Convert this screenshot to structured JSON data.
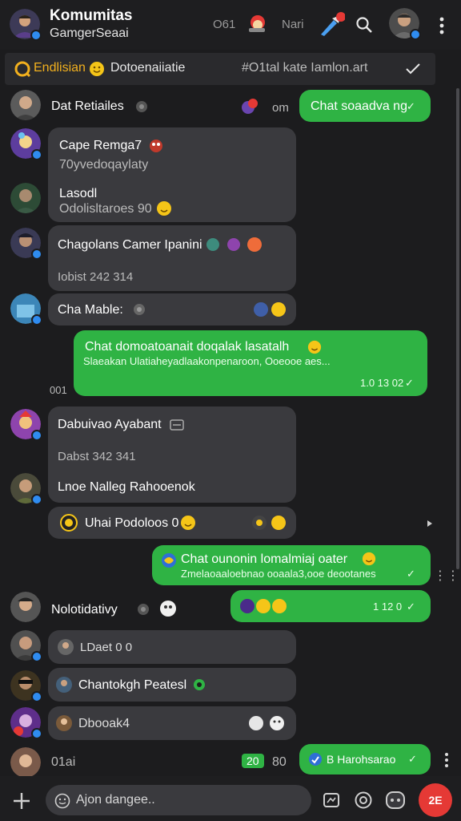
{
  "header": {
    "title": "Komumitas",
    "subtitle": "GamgerSeaai",
    "time_label": "O61",
    "alt_label": "Nari",
    "notif_count": "1"
  },
  "pinned": {
    "label": "Endlisian",
    "text": "Dotoenaiiatie",
    "right_text": "#O1tal kate Iamlon.art"
  },
  "messages": {
    "m1_name": "Dat Retiailes",
    "m1_time": "om",
    "m1_green": "Chat soaadva ng",
    "m2_title": "Cape Remga7",
    "m2_sub": "70yvedoqaylaty",
    "m2_title2": "Lasodl",
    "m2_sub2": "Odolisltaroes 90",
    "m3_title": "Chagolans Camer Ipanini",
    "m3_sub": "Iobist 242 314",
    "m4_title": "Cha Mable:",
    "m5_green_title": "Chat domoatoanait doqalak lasatalh",
    "m5_green_sub": "Slaeakan Ulatiaheyadlaakonpenaroon, Ooeooe aes...",
    "m5_time": "1.0 13 02",
    "m5_left": "001",
    "m6_title": "Dabuivao Ayabant",
    "m6_sub": "Dabst 342 341",
    "m6_title2": "Lnoe Nalleg Rahooenok",
    "m7_text": "Uhai Podoloos 0",
    "m8_green_title": "Chat ounonin lomalmiaj oater",
    "m8_green_sub": "Zmelaoaaloebnao ooaala3,ooe deootanes",
    "m9_name": "Nolotidativy",
    "m9_time": "1 12 0",
    "m10_text": "LDaet 0 0",
    "m11_text": "Chantokgh Peatesl",
    "m12_text": "Dbooak4",
    "m13_left": "01ai",
    "m13_badge": "20",
    "m13_num": "80",
    "m13_green": "B Harohsarao"
  },
  "input": {
    "placeholder": "Ajon dangee..",
    "send_badge": "2E"
  },
  "colors": {
    "green": "#2fb344",
    "bubble": "#3a3a3e",
    "background": "#1c1c1e",
    "accent_red": "#e53935"
  }
}
